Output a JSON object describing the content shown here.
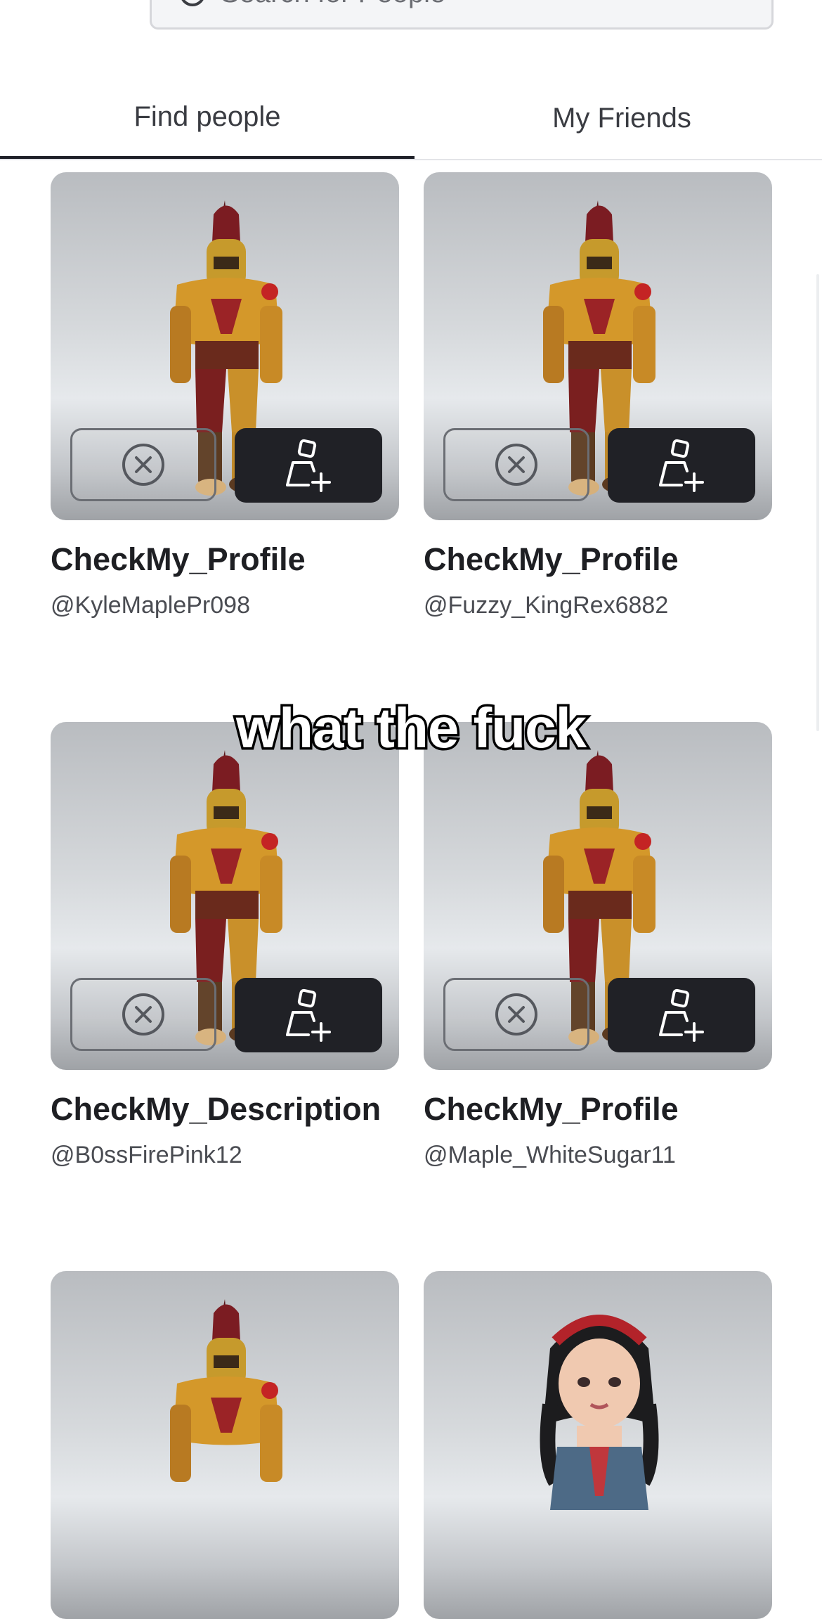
{
  "search": {
    "placeholder": "Search for People"
  },
  "tabs": [
    {
      "label": "Find people",
      "active": true
    },
    {
      "label": "My Friends",
      "active": false
    }
  ],
  "cards": [
    {
      "display_name": "CheckMy_Profile",
      "username": "@KyleMaplePr098",
      "avatar": "armored-knight-avatar"
    },
    {
      "display_name": "CheckMy_Profile",
      "username": "@Fuzzy_KingRex6882",
      "avatar": "armored-knight-avatar"
    },
    {
      "display_name": "CheckMy_Description",
      "username": "@B0ssFirePink12",
      "avatar": "armored-knight-avatar"
    },
    {
      "display_name": "CheckMy_Profile",
      "username": "@Maple_WhiteSugar11",
      "avatar": "armored-knight-avatar"
    },
    {
      "display_name": "",
      "username": "",
      "avatar": "armored-knight-avatar"
    },
    {
      "display_name": "",
      "username": "",
      "avatar": "girl-with-red-headband-avatar"
    }
  ],
  "caption": "what the fuck",
  "colors": {
    "add_button_bg": "#202126",
    "text_primary": "#1e1f23",
    "active_tab_underline": "#1e2028"
  }
}
